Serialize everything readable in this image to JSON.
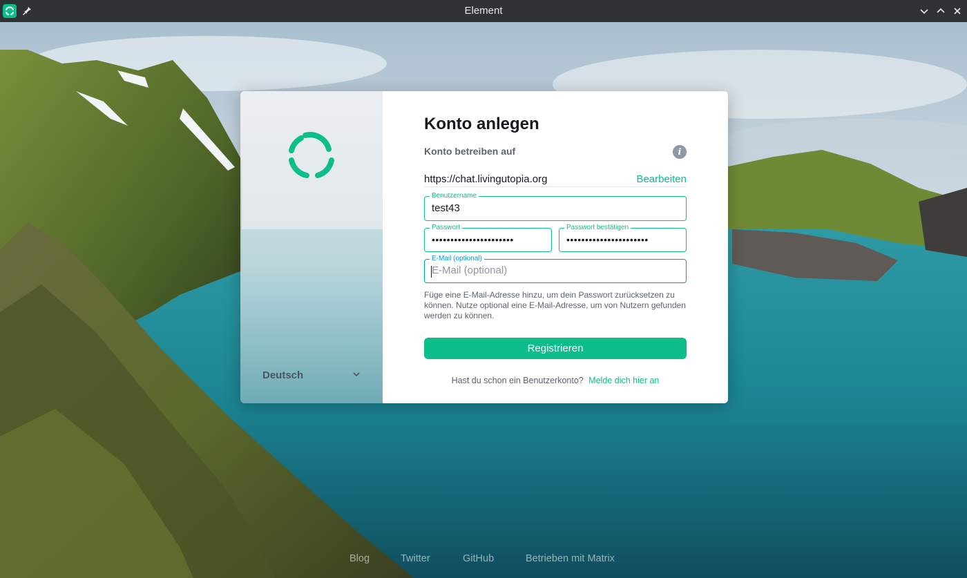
{
  "window": {
    "title": "Element",
    "icons": [
      "element-app-icon",
      "pin-icon",
      "minimize-icon",
      "maximize-icon",
      "close-icon"
    ]
  },
  "colors": {
    "accent": "#0dbd8b",
    "focus_blue": "#0098d4",
    "titlebar": "#2f3236"
  },
  "sidebar": {
    "language": "Deutsch"
  },
  "form": {
    "title": "Konto anlegen",
    "server_label": "Konto betreiben auf",
    "server_url": "https://chat.livingutopia.org",
    "edit_label": "Bearbeiten",
    "username": {
      "label": "Benutzername",
      "value": "test43"
    },
    "password": {
      "label": "Passwort",
      "value": "••••••••••••••••••••••"
    },
    "password_confirm": {
      "label": "Passwort bestätigen",
      "value": "••••••••••••••••••••••"
    },
    "email": {
      "label": "E-Mail (optional)",
      "placeholder": "E-Mail (optional)",
      "value": ""
    },
    "help_text": "Füge eine E-Mail-Adresse hinzu, um dein Passwort zurücksetzen zu können. Nutze optional eine E-Mail-Adresse, um von Nutzern gefunden werden zu können.",
    "submit_label": "Registrieren",
    "login_prompt": "Hast du schon ein Benutzerkonto?",
    "login_link": "Melde dich hier an"
  },
  "footer": {
    "links": [
      "Blog",
      "Twitter",
      "GitHub",
      "Betrieben mit Matrix"
    ]
  }
}
